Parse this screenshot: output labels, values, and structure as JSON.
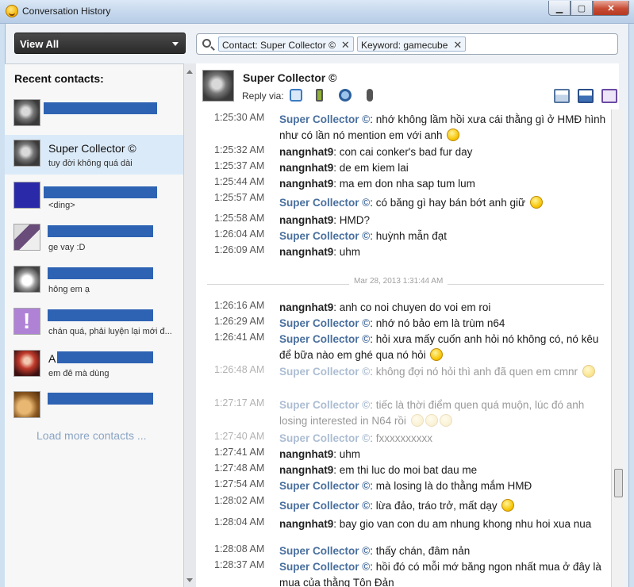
{
  "window": {
    "title": "Conversation History"
  },
  "filter": {
    "view_label": "View All"
  },
  "search": {
    "tokens": [
      {
        "label": "Contact: Super Collector ©"
      },
      {
        "label": "Keyword: gamecube"
      }
    ]
  },
  "sidebar": {
    "title": "Recent contacts:",
    "contacts": [
      {
        "name": "",
        "status": ""
      },
      {
        "name": "Super Collector ©",
        "status": "tuy đời không quá dài"
      },
      {
        "name": "",
        "status": "<ding>"
      },
      {
        "name": "",
        "status": "ge vay :D"
      },
      {
        "name": "",
        "status": "hông em ạ"
      },
      {
        "name": "",
        "status": "chán quá, phải luyện lại mới đ..."
      },
      {
        "name": "A",
        "status": "em đê mà dùng"
      },
      {
        "name": "",
        "status": ""
      }
    ],
    "load_more": "Load more contacts ..."
  },
  "conversation": {
    "contact_name": "Super Collector ©",
    "reply_via": "Reply via:",
    "divider_date": "Mar 28, 2013 1:31:44 AM",
    "messages": [
      {
        "time": "1:25:30 AM",
        "sender": "Super Collector ©",
        "text": ": nhớ không lầm hồi xưa cái thằng gì ở HMĐ hình như có lần nó mention em với anh"
      },
      {
        "time": "1:25:32 AM",
        "sender": "nangnhat9",
        "text": ": con cai conker's bad fur day"
      },
      {
        "time": "1:25:37 AM",
        "sender": "nangnhat9",
        "text": ": de em kiem lai"
      },
      {
        "time": "1:25:44 AM",
        "sender": "nangnhat9",
        "text": ": ma em don nha sap tum lum"
      },
      {
        "time": "1:25:57 AM",
        "sender": "Super Collector ©",
        "text": ": có băng gì hay bán bớt anh giữ"
      },
      {
        "time": "1:25:58 AM",
        "sender": "nangnhat9",
        "text": ": HMD?"
      },
      {
        "time": "1:26:04 AM",
        "sender": "Super Collector ©",
        "text": ": huỳnh mẫn đạt"
      },
      {
        "time": "1:26:09 AM",
        "sender": "nangnhat9",
        "text": ": uhm"
      },
      {
        "time": "1:26:16 AM",
        "sender": "nangnhat9",
        "text": ": anh co noi chuyen do voi em roi"
      },
      {
        "time": "1:26:29 AM",
        "sender": "Super Collector ©",
        "text": ": nhớ nó bảo em là trùm n64"
      },
      {
        "time": "1:26:41 AM",
        "sender": "Super Collector ©",
        "text": ": hỏi xưa mấy cuốn anh hỏi nó không có, nó kêu để bữa nào em ghé qua nó hỏi"
      },
      {
        "time": "1:26:48 AM",
        "sender": "Super Collector ©",
        "text": ": không đợi nó hỏi thì anh đã quen em cmnr"
      },
      {
        "time": "1:27:17 AM",
        "sender": "Super Collector ©",
        "text": ": tiếc là thời điểm quen quá muộn, lúc đó anh losing interested in N64 rồi"
      },
      {
        "time": "1:27:40 AM",
        "sender": "Super Collector ©",
        "text": ": fxxxxxxxxxx"
      },
      {
        "time": "1:27:41 AM",
        "sender": "nangnhat9",
        "text": ": uhm"
      },
      {
        "time": "1:27:48 AM",
        "sender": "nangnhat9",
        "text": ": em thi luc do moi bat dau me"
      },
      {
        "time": "1:27:54 AM",
        "sender": "Super Collector ©",
        "text": ": mà losing là do thằng mắm HMĐ"
      },
      {
        "time": "1:28:02 AM",
        "sender": "Super Collector ©",
        "text": ": lừa đảo, tráo trở, mất dạy"
      },
      {
        "time": "1:28:04 AM",
        "sender": "nangnhat9",
        "text": ": bay gio van con du am nhung khong nhu hoi xua nua"
      },
      {
        "time": "1:28:08 AM",
        "sender": "Super Collector ©",
        "text": ": thấy chán, đâm nản"
      },
      {
        "time": "1:28:37 AM",
        "sender": "Super Collector ©",
        "text": ": hồi đó có mỗi mớ băng ngon nhất mua ở đây là mua của thằng Tôn Đản"
      }
    ]
  }
}
